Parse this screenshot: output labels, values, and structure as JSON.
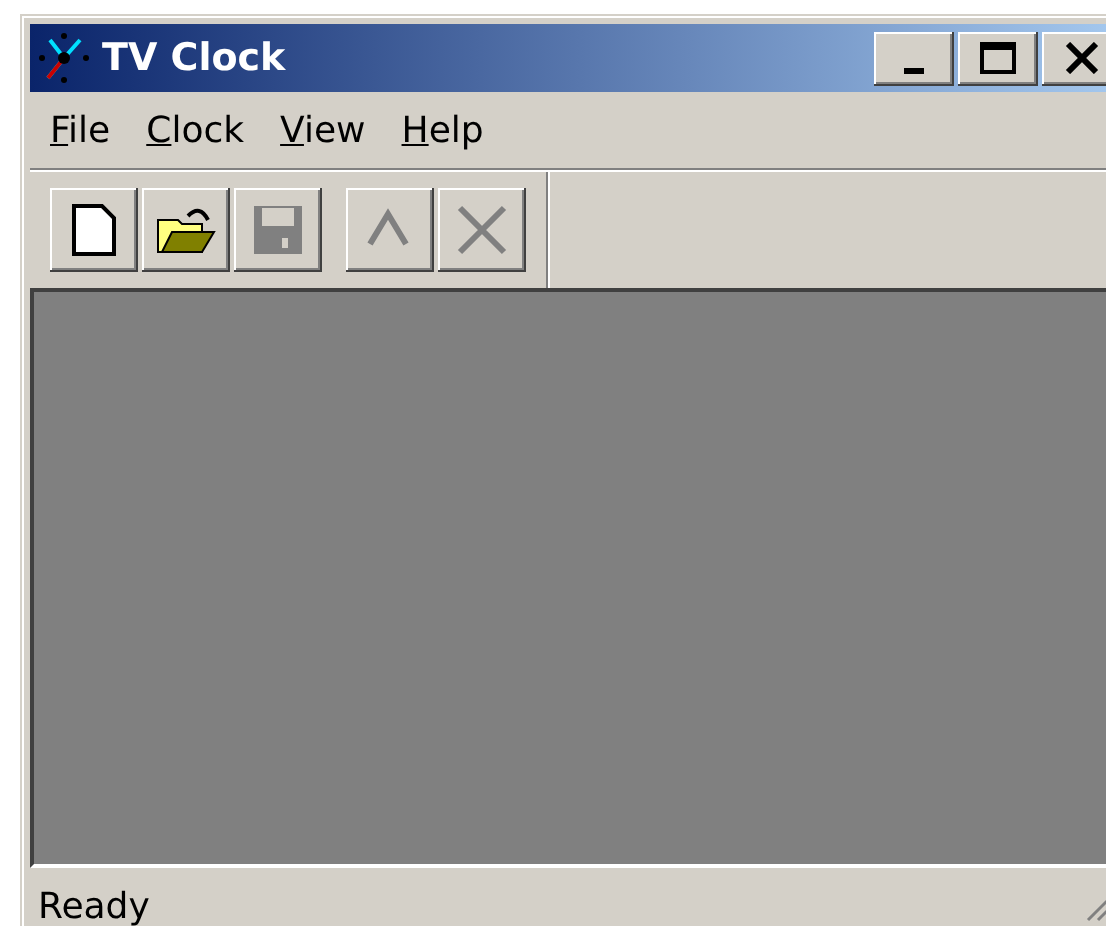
{
  "window": {
    "title": "TV Clock"
  },
  "menu": [
    {
      "label": "File"
    },
    {
      "label": "Clock"
    },
    {
      "label": "View"
    },
    {
      "label": "Help"
    }
  ],
  "toolbar": {
    "groups": [
      [
        {
          "kind": "new",
          "disabled": false
        },
        {
          "kind": "open",
          "disabled": false
        },
        {
          "kind": "save",
          "disabled": true
        }
      ],
      [
        {
          "kind": "up",
          "disabled": true
        },
        {
          "kind": "delete",
          "disabled": true
        }
      ]
    ]
  },
  "status_bar": {
    "text": "Ready"
  }
}
